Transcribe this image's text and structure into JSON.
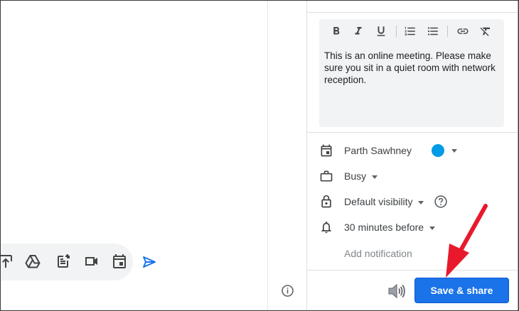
{
  "description": {
    "text": "This is an online meeting. Please make sure you sit in a quiet room with network reception."
  },
  "toolbar": {
    "icons": [
      "bold-icon",
      "italic-icon",
      "underline-icon",
      "numbered-list-icon",
      "bulleted-list-icon",
      "link-icon",
      "remove-formatting-icon"
    ]
  },
  "calendar": {
    "owner": "Parth Sawhney",
    "color": "#039be5"
  },
  "availability": {
    "value": "Busy"
  },
  "visibility": {
    "value": "Default visibility"
  },
  "notification": {
    "value": "30 minutes before",
    "add_label": "Add notification"
  },
  "footer": {
    "save_label": "Save & share"
  },
  "colors": {
    "accent": "#1a73e8",
    "annotation_arrow": "#e8192c"
  }
}
